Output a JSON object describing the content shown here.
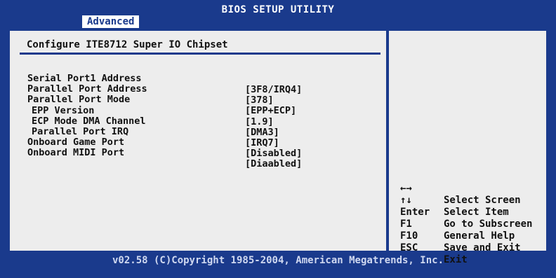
{
  "header": {
    "title": "BIOS SETUP UTILITY",
    "active_tab": "Advanced"
  },
  "main": {
    "section_title": "Configure ITE8712 Super IO Chipset",
    "settings": [
      {
        "label": "Serial Port1 Address",
        "value": "[3F8/IRQ4]"
      },
      {
        "label": "Parallel Port Address",
        "value": "[378]"
      },
      {
        "label": "Parallel Port Mode",
        "value": "[EPP+ECP]"
      },
      {
        "label": "EPP Version",
        "value": "[1.9]"
      },
      {
        "label": "ECP Mode DMA Channel",
        "value": "[DMA3]"
      },
      {
        "label": "Parallel Port IRQ",
        "value": "[IRQ7]"
      },
      {
        "label": "Onboard Game Port",
        "value": "[Disabled]"
      },
      {
        "label": "Onboard MIDI Port",
        "value": "[Diaabled]"
      }
    ]
  },
  "help": {
    "items": [
      {
        "key": "←→",
        "desc": "Select Screen",
        "icon": "left-right-arrows-icon"
      },
      {
        "key": "↑↓",
        "desc": "Select Item",
        "icon": "up-down-arrows-icon"
      },
      {
        "key": "Enter",
        "desc": "Go to Subscreen"
      },
      {
        "key": "F1",
        "desc": "General Help"
      },
      {
        "key": "F10",
        "desc": "Save and Exit"
      },
      {
        "key": "ESC",
        "desc": "Exit"
      }
    ]
  },
  "footer": {
    "copyright": "v02.58 (C)Copyright 1985-2004, American Megatrends, Inc."
  },
  "colors": {
    "background": "#1a3a8c",
    "panel": "#ededed",
    "text": "#111111",
    "highlight": "#ffffff"
  }
}
